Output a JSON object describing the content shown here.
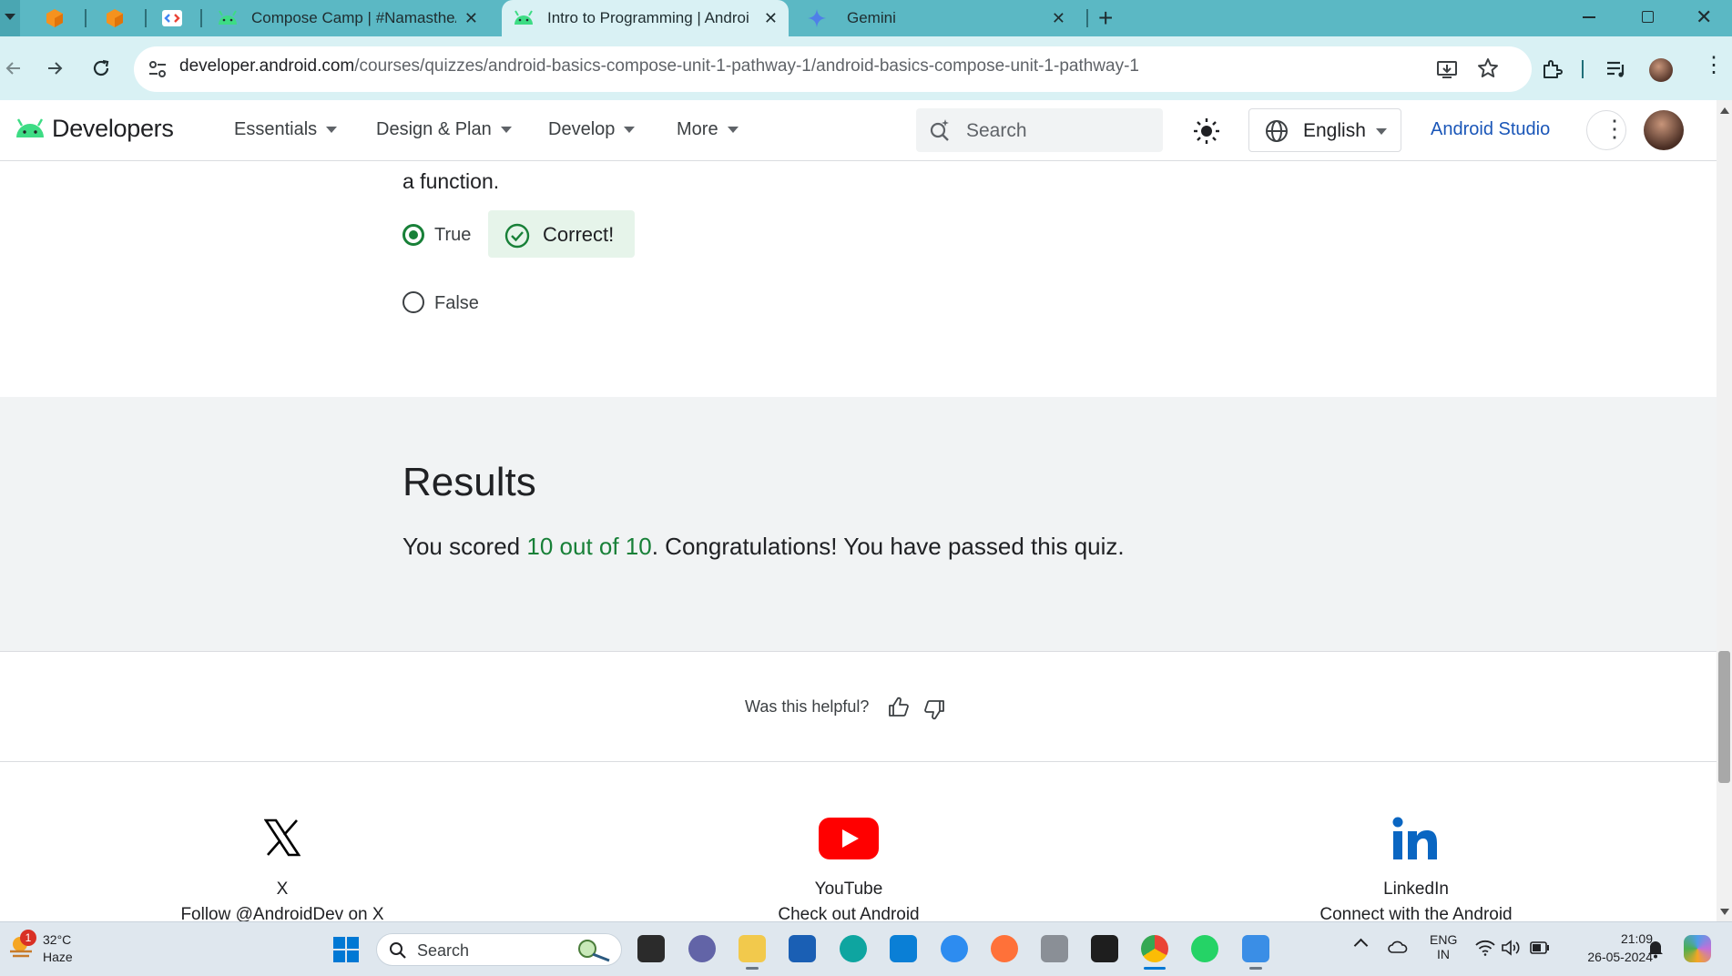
{
  "browser": {
    "tabs": [
      {
        "label": "",
        "icon": "orange-cube-icon"
      },
      {
        "label": "",
        "icon": "orange-cube-icon"
      },
      {
        "label": "",
        "icon": "code-brackets-icon"
      },
      {
        "label": "Compose Camp | #NamastheAn",
        "icon": "android-icon"
      },
      {
        "label": "Intro to Programming  |  Androi",
        "icon": "android-icon",
        "active": true
      },
      {
        "label": "Gemini",
        "icon": "gemini-sparkle-icon"
      }
    ],
    "url_host": "developer.android.com",
    "url_path": "/courses/quizzes/android-basics-compose-unit-1-pathway-1/android-basics-compose-unit-1-pathway-1"
  },
  "header": {
    "brand": "Developers",
    "nav": [
      "Essentials",
      "Design & Plan",
      "Develop",
      "More"
    ],
    "search_placeholder": "Search",
    "language": "English",
    "studio_link": "Android Studio"
  },
  "question": {
    "tail_text": "a function.",
    "options": [
      {
        "label": "True",
        "selected": true
      },
      {
        "label": "False",
        "selected": false
      }
    ],
    "feedback": "Correct!"
  },
  "results": {
    "heading": "Results",
    "prefix": "You scored ",
    "score": "10 out of 10",
    "suffix": ". Congratulations! You have passed this quiz."
  },
  "feedback": {
    "question": "Was this helpful?"
  },
  "footer": {
    "social": [
      {
        "name": "X",
        "desc": "Follow @AndroidDev on X",
        "icon": "x-logo-icon"
      },
      {
        "name": "YouTube",
        "desc": "Check out Android",
        "icon": "youtube-logo-icon"
      },
      {
        "name": "LinkedIn",
        "desc": "Connect with the Android",
        "icon": "linkedin-logo-icon"
      }
    ]
  },
  "taskbar": {
    "weather_temp": "32°C",
    "weather_desc": "Haze",
    "weather_badge": "1",
    "search_placeholder": "Search",
    "lang_line1": "ENG",
    "lang_line2": "IN",
    "time": "21:09",
    "date": "26-05-2024"
  },
  "colors": {
    "tabbar": "#5bb8c4",
    "toolbar": "#d9f1f4",
    "android_green": "#3ddc84",
    "correct_green": "#188038",
    "correct_bg": "#e6f4ea",
    "link_blue": "#1a56b8"
  }
}
